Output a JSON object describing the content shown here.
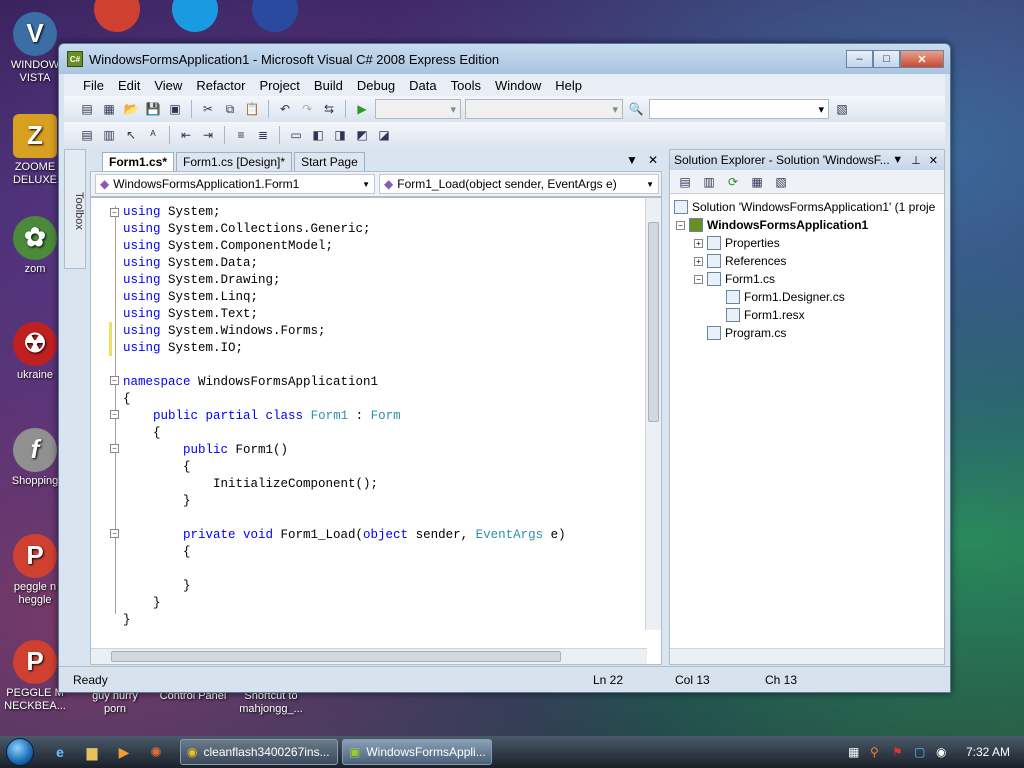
{
  "desktop": {
    "icons": [
      {
        "label1": "WINDOW",
        "label2": "VISTA",
        "color": "#3a6ea5",
        "glyph": "V"
      },
      {
        "label1": "ZOOME",
        "label2": "DELUXE",
        "color": "#d8a020",
        "glyph": "Z"
      },
      {
        "label1": "zom",
        "label2": "",
        "color": "#4a8a3a",
        "glyph": "✿"
      },
      {
        "label1": "ukraine",
        "label2": "",
        "color": "#c02020",
        "glyph": "☢"
      },
      {
        "label1": "Shopping",
        "label2": "",
        "color": "#909090",
        "glyph": "f"
      },
      {
        "label1": "peggle n",
        "label2": "heggle",
        "color": "#d04030",
        "glyph": "P"
      },
      {
        "label1": "PEGGLE M",
        "label2": "NECKBEA...",
        "color": "#d04030",
        "glyph": "P"
      }
    ],
    "bottom_labels": [
      "guy hurry",
      "porn",
      "Control Panel",
      "Shortcut to",
      "mahjongg_..."
    ]
  },
  "window": {
    "title": "WindowsFormsApplication1 - Microsoft Visual C# 2008 Express Edition",
    "app_icon": "C#",
    "minimize": "–",
    "maximize": "□",
    "close": "✕"
  },
  "menu": [
    "File",
    "Edit",
    "View",
    "Refactor",
    "Project",
    "Build",
    "Debug",
    "Data",
    "Tools",
    "Window",
    "Help"
  ],
  "toolbox_label": "Toolbox",
  "tabs": [
    "Form1.cs*",
    "Form1.cs [Design]*",
    "Start Page"
  ],
  "nav": {
    "class_combo": "WindowsFormsApplication1.Form1",
    "member_combo": "Form1_Load(object sender, EventArgs e)"
  },
  "solution_explorer": {
    "title": "Solution Explorer - Solution 'WindowsF...",
    "items": [
      "Solution 'WindowsFormsApplication1' (1 proje",
      "WindowsFormsApplication1",
      "Properties",
      "References",
      "Form1.cs",
      "Form1.Designer.cs",
      "Form1.resx",
      "Program.cs"
    ]
  },
  "status": {
    "text": "Ready",
    "ln": "Ln 22",
    "col": "Col 13",
    "ch": "Ch 13"
  },
  "taskbar": {
    "buttons": [
      "cleanflash3400267ins...",
      "WindowsFormsAppli..."
    ],
    "clock": "7:32 AM"
  }
}
